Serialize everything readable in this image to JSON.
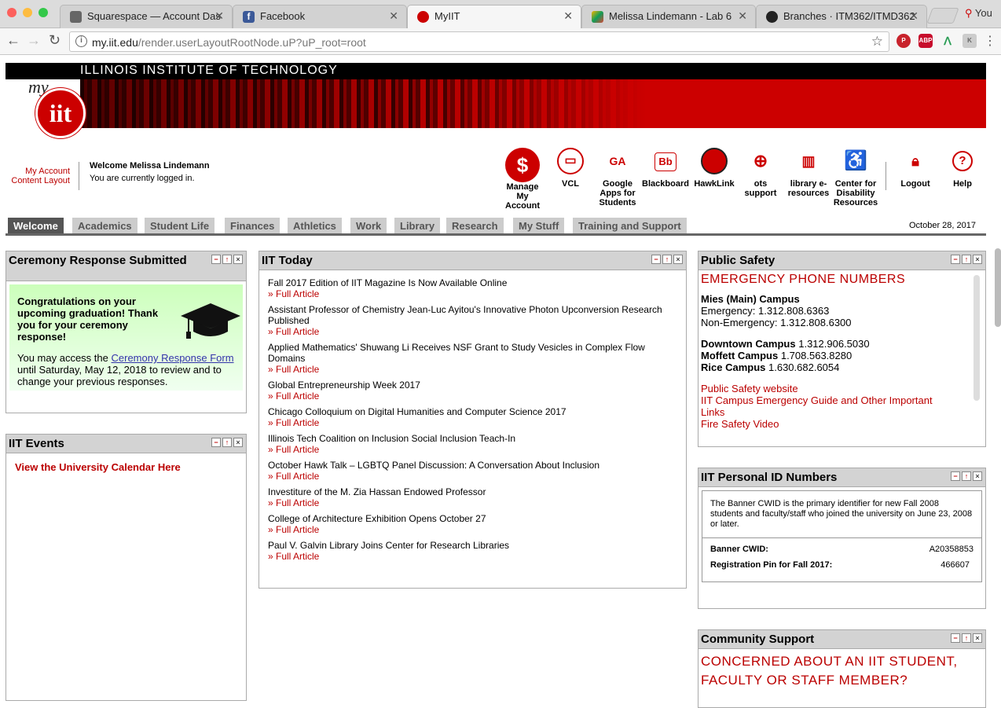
{
  "browser": {
    "tabs": [
      {
        "title": "Squarespace — Account Das",
        "icon": "squarespace-icon"
      },
      {
        "title": "Facebook",
        "icon": "facebook-icon"
      },
      {
        "title": "MyIIT",
        "icon": "iit-icon"
      },
      {
        "title": "Melissa Lindemann - Lab 6",
        "icon": "codepen-icon"
      },
      {
        "title": "Branches · ITM362/ITMD362",
        "icon": "github-icon"
      }
    ],
    "profile": "You",
    "url_host": "my.iit.edu",
    "url_path": "/render.userLayoutRootNode.uP?uP_root=root",
    "extensions": [
      "ABP"
    ]
  },
  "header": {
    "school_name": "ILLINOIS INSTITUTE OF TECHNOLOGY",
    "logo_my": "my",
    "logo_iit": "iit"
  },
  "account": {
    "my_account": "My Account",
    "content_layout": "Content Layout",
    "welcome": "Welcome Melissa Lindemann",
    "status": "You are currently logged in."
  },
  "quick_links": [
    {
      "label": "Manage My Account",
      "icon": "dollar-icon"
    },
    {
      "label": "VCL",
      "icon": "monitor-icon"
    },
    {
      "label": "Google Apps for Students",
      "icon": "google-apps-icon"
    },
    {
      "label": "Blackboard",
      "icon": "blackboard-icon"
    },
    {
      "label": "HawkLink",
      "icon": "hawk-icon"
    },
    {
      "label": "ots support",
      "icon": "plus-icon"
    },
    {
      "label": "library e-resources",
      "icon": "library-icon"
    },
    {
      "label": "Center for Disability Resources",
      "icon": "wheelchair-icon"
    },
    {
      "label": "Logout",
      "icon": "lock-icon"
    },
    {
      "label": "Help",
      "icon": "help-icon"
    }
  ],
  "nav_tabs": [
    "Welcome",
    "Academics",
    "Student Life",
    "Finances",
    "Athletics",
    "Work",
    "Library",
    "Research",
    "My Stuff",
    "Training and Support"
  ],
  "date": "October 28, 2017",
  "ceremony": {
    "title": "Ceremony Response Submitted",
    "headline": "Congratulations on your upcoming graduation! Thank you for your ceremony response!",
    "body_pre": "You may access the",
    "link": "Ceremony Response Form",
    "body_post": "until Saturday, May 12, 2018 to review and to change your previous responses."
  },
  "events": {
    "title": "IIT Events",
    "link": "View the University Calendar Here"
  },
  "today": {
    "title": "IIT Today",
    "full_article": "» Full Article",
    "items": [
      "Fall 2017 Edition of IIT Magazine Is Now Available Online",
      "Assistant Professor of Chemistry Jean-Luc Ayitou's Innovative Photon Upconversion Research Published",
      "Applied Mathematics' Shuwang Li Receives NSF Grant to Study Vesicles in Complex Flow Domains",
      "Global Entrepreneurship Week 2017",
      "Chicago Colloquium on Digital Humanities and Computer Science 2017",
      "Illinois Tech Coalition on Inclusion Social Inclusion Teach-In",
      "October Hawk Talk – LGBTQ Panel Discussion: A Conversation About Inclusion",
      "Investiture of the M. Zia Hassan Endowed Professor",
      "College of Architecture Exhibition Opens October 27",
      "Paul V. Galvin Library Joins Center for Research Libraries"
    ]
  },
  "safety": {
    "title": "Public Safety",
    "caption": "EMERGENCY PHONE NUMBERS",
    "mies_name": "Mies (Main) Campus",
    "mies_emergency": "Emergency: 1.312.808.6363",
    "mies_non": "Non-Emergency: 1.312.808.6300",
    "campuses": [
      {
        "name": "Downtown Campus",
        "phone": "1.312.906.5030"
      },
      {
        "name": "Moffett Campus",
        "phone": "1.708.563.8280"
      },
      {
        "name": "Rice Campus",
        "phone": "1.630.682.6054"
      }
    ],
    "links": [
      "Public Safety website",
      "IIT Campus Emergency Guide and Other Important Links",
      "Fire Safety Video"
    ]
  },
  "idnums": {
    "title": "IIT Personal ID Numbers",
    "desc": "The Banner CWID is the primary identifier for new Fall 2008 students and faculty/staff who joined the university on June 23, 2008 or later.",
    "cwid_label": "Banner CWID:",
    "cwid_value": "A20358853",
    "pin_label": "Registration Pin for Fall 2017:",
    "pin_value": "466607"
  },
  "community": {
    "title": "Community Support",
    "caption": "CONCERNED ABOUT AN IIT STUDENT, FACULTY OR STAFF MEMBER?"
  },
  "portlet_buttons": {
    "minimize": "−",
    "maximize": "↑",
    "close": "×"
  },
  "colors": {
    "brand_red": "#cc0000",
    "link_red": "#bb0000"
  }
}
